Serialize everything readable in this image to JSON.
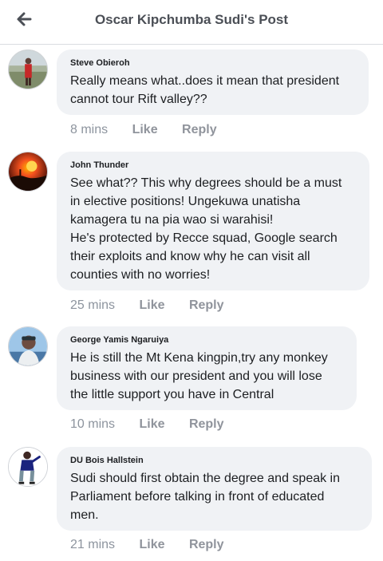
{
  "header": {
    "title": "Oscar Kipchumba Sudi's Post",
    "back_icon": "arrow-left-icon"
  },
  "comments": [
    {
      "author": "Steve Obieroh",
      "lines": [
        "Really means what..does it mean that president",
        "cannot tour Rift valley??"
      ],
      "time": "8 mins",
      "like": "Like",
      "reply": "Reply"
    },
    {
      "author": "John Thunder",
      "lines": [
        "See what?? This why degrees should be a must",
        "in elective positions! Ungekuwa unatisha",
        "kamagera tu na pia wao si warahisi!",
        "He's protected by Recce squad, Google search",
        "their exploits and know why he can visit all",
        "counties with no worries!"
      ],
      "time": "25 mins",
      "like": "Like",
      "reply": "Reply"
    },
    {
      "author": "George Yamis Ngaruiya",
      "lines": [
        "He is still the Mt Kena kingpin,try any monkey",
        "business with our president and you will lose",
        "the little support you have in Central"
      ],
      "time": "10 mins",
      "like": "Like",
      "reply": "Reply"
    },
    {
      "author": "DU Bois Hallstein",
      "lines": [
        "Sudi should first obtain the degree and speak in",
        "Parliament before talking in front of educated",
        "men."
      ],
      "time": "21 mins",
      "like": "Like",
      "reply": "Reply"
    }
  ]
}
